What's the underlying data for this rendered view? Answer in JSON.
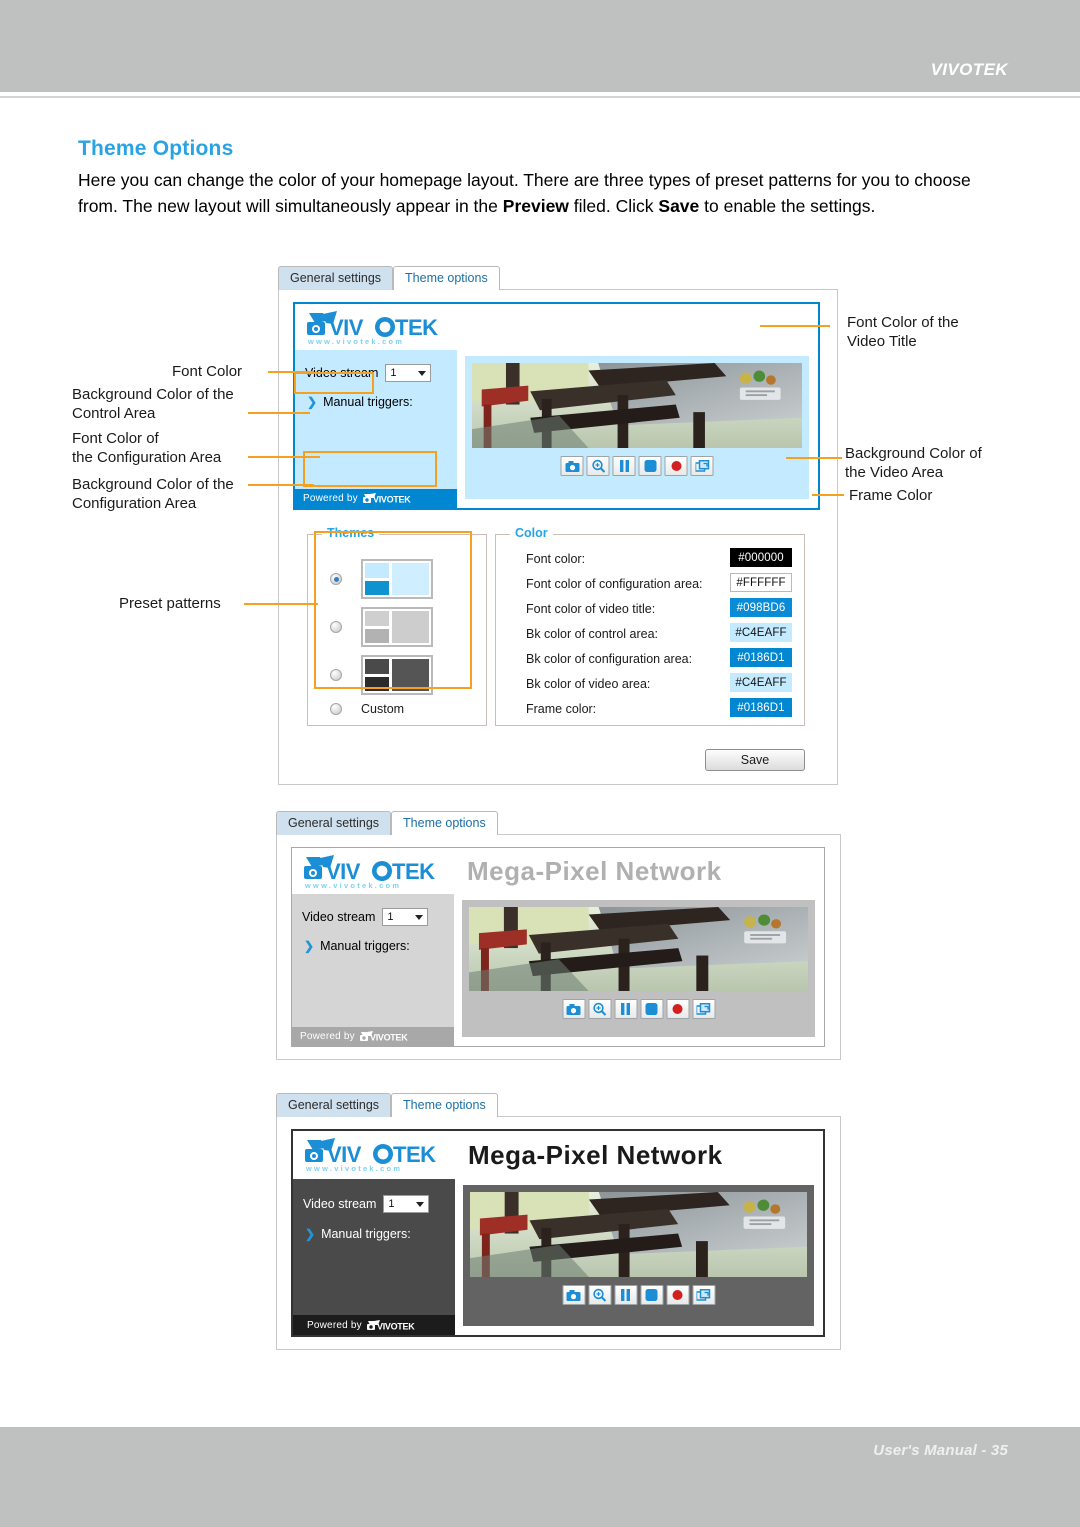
{
  "page": {
    "header_brand": "VIVOTEK",
    "footer": "User's Manual - 35"
  },
  "section": {
    "title": "Theme Options",
    "body_1": "Here you can change the color of your homepage layout. There are three types of preset patterns for you to choose from. The new layout will simultaneously appear in the ",
    "body_bold_1": "Preview",
    "body_2": " filed. Click ",
    "body_bold_2": "Save",
    "body_3": " to enable the settings."
  },
  "callouts": {
    "font_color": "Font Color",
    "bk_control_area": "Background Color of the\nControl Area",
    "font_config_area": "Font Color of\nthe Configuration Area",
    "bk_config_area": "Background Color of the\nConfiguration Area",
    "preset_patterns": "Preset patterns",
    "font_video_title": "Font Color of the\nVideo Title",
    "bk_video_area": "Background Color of\nthe Video Area",
    "frame_color": "Frame Color"
  },
  "screens": [
    {
      "id": "screen-blue",
      "tabs": [
        {
          "label": "General settings",
          "active": false
        },
        {
          "label": "Theme options",
          "active": true
        }
      ],
      "preview": {
        "video_title": "",
        "video_stream_label": "Video stream",
        "video_stream_value": "1",
        "manual_triggers_label": "Manual triggers:",
        "powered_by": "Powered by",
        "powered_brand": "VIVOTEK",
        "logo_text": "VIVOTEK",
        "logo_url": "www.vivotek.com",
        "controls": [
          "snapshot-icon",
          "digital-zoom-icon",
          "pause-icon",
          "stop-icon",
          "record-icon",
          "fullscreen-icon"
        ]
      },
      "themes": {
        "legend": "Themes",
        "custom_label": "Custom",
        "selected_index": 0,
        "options": [
          {
            "name": "theme-blue"
          },
          {
            "name": "theme-gray"
          },
          {
            "name": "theme-dark"
          }
        ]
      },
      "color": {
        "legend": "Color",
        "rows": [
          {
            "label": "Font color:",
            "value": "#000000",
            "bg": "#000000",
            "fg": "#ffffff",
            "border": "#000000"
          },
          {
            "label": "Font color of configuration area:",
            "value": "#FFFFFF",
            "bg": "#ffffff",
            "fg": "#111111",
            "border": "#b9b9b9"
          },
          {
            "label": "Font color of video title:",
            "value": "#098BD6",
            "bg": "#098bd6",
            "fg": "#ffffff",
            "border": "#098bd6"
          },
          {
            "label": "Bk color of control area:",
            "value": "#C4EAFF",
            "bg": "#c4eaff",
            "fg": "#111111",
            "border": "#c4eaff"
          },
          {
            "label": "Bk color of configuration area:",
            "value": "#0186D1",
            "bg": "#0186d1",
            "fg": "#ffffff",
            "border": "#0186d1"
          },
          {
            "label": "Bk color of video area:",
            "value": "#C4EAFF",
            "bg": "#c4eaff",
            "fg": "#111111",
            "border": "#c4eaff"
          },
          {
            "label": "Frame color:",
            "value": "#0186D1",
            "bg": "#0186d1",
            "fg": "#ffffff",
            "border": "#0186d1"
          }
        ]
      },
      "save_label": "Save"
    },
    {
      "id": "screen-gray",
      "tabs": [
        {
          "label": "General settings",
          "active": false
        },
        {
          "label": "Theme options",
          "active": true
        }
      ],
      "preview": {
        "video_title": "Mega-Pixel Network",
        "video_stream_label": "Video stream",
        "video_stream_value": "1",
        "manual_triggers_label": "Manual triggers:",
        "powered_by": "Powered by",
        "powered_brand": "VIVOTEK",
        "logo_text": "VIVOTEK",
        "logo_url": "www.vivotek.com",
        "controls": [
          "snapshot-icon",
          "digital-zoom-icon",
          "pause-icon",
          "stop-icon",
          "record-icon",
          "fullscreen-icon"
        ]
      },
      "theme_colors": {
        "font_color": "#000000",
        "font_color_config": "#FFFFFF",
        "font_color_title": "#B0B0B0",
        "bk_control": "#D5D5D5",
        "bk_config": "#A8A8A8",
        "bk_video": "#C0C0C0",
        "frame": "#A8A8A8"
      }
    },
    {
      "id": "screen-dark",
      "tabs": [
        {
          "label": "General settings",
          "active": false
        },
        {
          "label": "Theme options",
          "active": true
        }
      ],
      "preview": {
        "video_title": "Mega-Pixel Network",
        "video_stream_label": "Video stream",
        "video_stream_value": "1",
        "manual_triggers_label": "Manual triggers:",
        "powered_by": "Powered by",
        "powered_brand": "VIVOTEK",
        "logo_text": "VIVOTEK",
        "logo_url": "www.vivotek.com",
        "controls": [
          "snapshot-icon",
          "digital-zoom-icon",
          "pause-icon",
          "stop-icon",
          "record-icon",
          "fullscreen-icon"
        ]
      },
      "theme_colors": {
        "font_color": "#000000",
        "font_color_config": "#FFFFFF",
        "font_color_title": "#1A1A1A",
        "bk_control": "#4A4A4A",
        "bk_config": "#1C1C1C",
        "bk_video": "#636363",
        "frame": "#333333"
      }
    }
  ]
}
